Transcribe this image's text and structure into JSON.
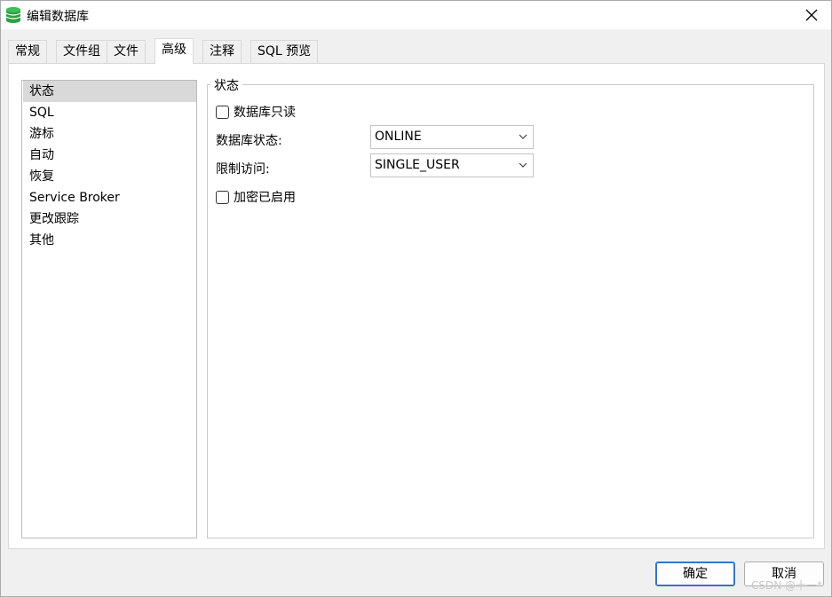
{
  "window": {
    "title": "编辑数据库",
    "icon": "database-icon",
    "accent": "#2ea043"
  },
  "tabs": [
    {
      "label": "常规"
    },
    {
      "label": "文件组"
    },
    {
      "label": "文件"
    },
    {
      "label": "高级",
      "active": true
    },
    {
      "label": "注释"
    },
    {
      "label": "SQL 预览"
    }
  ],
  "nav": {
    "items": [
      {
        "label": "状态",
        "selected": true
      },
      {
        "label": "SQL"
      },
      {
        "label": "游标"
      },
      {
        "label": "自动"
      },
      {
        "label": "恢复"
      },
      {
        "label": "Service Broker"
      },
      {
        "label": "更改跟踪"
      },
      {
        "label": "其他"
      }
    ]
  },
  "status_group": {
    "title": "状态",
    "readonly_label": "数据库只读",
    "readonly_checked": false,
    "state_label": "数据库状态:",
    "state_value": "ONLINE",
    "access_label": "限制访问:",
    "access_value": "SINGLE_USER",
    "encryption_label": "加密已启用",
    "encryption_checked": false
  },
  "footer": {
    "ok_label": "确定",
    "cancel_label": "取消",
    "watermark": "CSDN @十一*"
  }
}
